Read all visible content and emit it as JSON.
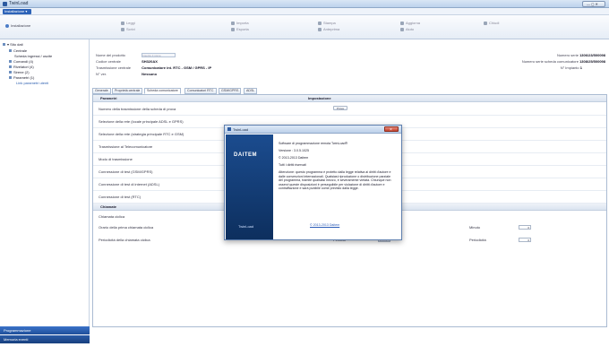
{
  "window": {
    "title": "TwinLoad",
    "controls": "— ◻ ✕"
  },
  "menu": {
    "file_label": "Installazione ▾"
  },
  "toolbar": {
    "left_label": "Installazione",
    "groups": [
      {
        "l1": "Leggi",
        "l2": "Scrivi"
      },
      {
        "l1": "Importa",
        "l2": "Esporta"
      },
      {
        "l1": "Stampa",
        "l2": "Anteprima"
      },
      {
        "l1": "Aggiorna",
        "l2": "Aiuto"
      },
      {
        "l1": "Chiudi",
        "l2": ""
      }
    ]
  },
  "tree": {
    "items": [
      "▾ Sito dati",
      "Centrale",
      "Scheda ingressi / uscite",
      "Comandi (4)",
      "Rivelatori (4)",
      "Sirene (2)",
      "Parametri (1)",
      "Link parametri utenti"
    ]
  },
  "sidebar_buttons": {
    "primary": "Programmazione",
    "secondary": "Memoria eventi"
  },
  "info": {
    "name_label": "Nome del prodotto",
    "name_value": "Inserire il nome",
    "code_label": "Codice centrale",
    "code_value": "SH320AX",
    "comm_label": "Trasmissione centrale",
    "comm_value": "Comunicatore int. RTC - GSM / GPRS - IP",
    "ver_label": "N° ver.",
    "ver_value": "Nessuno",
    "r_serial_label": "Numero serie",
    "r_serial_value": "1306/23/500098",
    "r_code_label": "Numero serie scheda comunicatore",
    "r_code_value": "1308/25/500098",
    "r_count_label": "N° Impianto",
    "r_count_value": "1"
  },
  "tabs": [
    "Generale",
    "Proprietà centrale",
    "Scheda comunicatore",
    "Comunicatori RTC",
    "GSM/GPRS",
    "ADSL"
  ],
  "section1": {
    "title": "Parametri",
    "col2": "Impostazione"
  },
  "params": [
    {
      "label": "Numero della trasmissione della scheda di prova",
      "value": "Prova"
    },
    {
      "label": "Selezione della rete (locale principale ADSL e GPRS)",
      "value": ""
    },
    {
      "label": "Selezione della rete (strategia principale RTC e GSM)",
      "value": ""
    },
    {
      "label": "Trasmissione al Telecomunicatore",
      "value": ""
    },
    {
      "label": "Modo di trasmissione",
      "value": ""
    },
    {
      "label": "Connessione di test (GSM/GPRS)",
      "value": ""
    },
    {
      "label": "Connessione di test di internet (ADSL)",
      "value": ""
    },
    {
      "label": "Connessione di test (RTC)",
      "value": ""
    }
  ],
  "section2": {
    "title": "Chiamate"
  },
  "calls": {
    "row0": "Chiamata ciclica",
    "row1_label": "Orario della prima chiamata ciclica",
    "row1_c1": "Ora",
    "row1_v1": "0",
    "row1_c2": "Minuto",
    "row1_v2": "0",
    "row2_label": "Periodicità della chiamata ciclica",
    "row2_c1": "Periodo",
    "row2_v1": "Nessuno",
    "row2_c2": "Periodicità",
    "row2_v2": "0"
  },
  "dialog": {
    "title": "TwinLoad",
    "brand": "DAITEM",
    "bottom": "TwinLoad",
    "line1": "Software di programmazione remota TwinLoad®",
    "line2": "Versione : 3.0.5.1025",
    "line3": "© 2013-2013 Daitem",
    "line4": "Tutti i diritti riservati",
    "warning": "Attenzione: questo programma è protetto dalla legge relativa ai diritti d'autore e dalle convenzioni internazionali. Qualsiasi riproduzione o distribuzione parziale del programma, tramite qualsiasi mezzo, è severamente vietata. Chiunque non osservi queste disposizioni è perseguibile per violazione di diritti d'autore e contraffazione e sarà punibile come previsto dalla legge.",
    "link": "© 2013-2013 Daitem"
  }
}
